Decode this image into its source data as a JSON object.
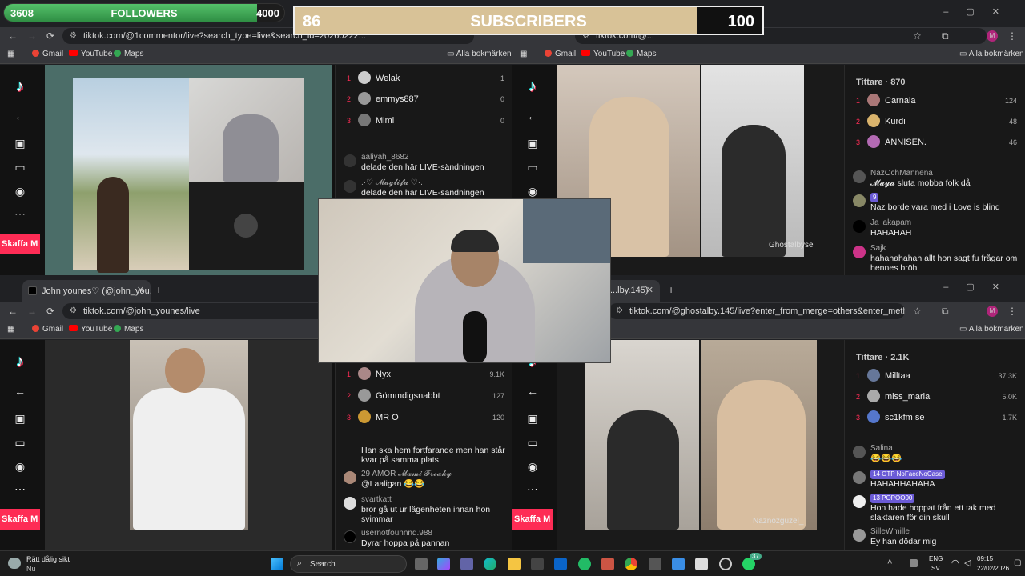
{
  "followers_bar": {
    "current": "3608",
    "label": "FOLLOWERS",
    "goal": "4000",
    "progress": 0.902
  },
  "subscribers_bar": {
    "current": "86",
    "label": "SUBSCRIBERS",
    "goal": "100",
    "progress": 0.86
  },
  "bookmarks": {
    "gmail": "Gmail",
    "youtube": "YouTube",
    "maps": "Maps",
    "all": "Alla bokmärken"
  },
  "win_tl": {
    "url": "tiktok.com/@1commentor/live?search_type=live&search_id=20260222...",
    "viewers": [
      {
        "rank": "1",
        "name": "Welak",
        "score": "1"
      },
      {
        "rank": "2",
        "name": "emmys887",
        "score": "0"
      },
      {
        "rank": "3",
        "name": "Mimi",
        "score": "0"
      }
    ],
    "events": [
      {
        "user": "aaliyah_8682",
        "text": "delade den här LIVE-sändningen"
      },
      {
        "user": ".·♡ 𝓜𝓪𝓰𝓵𝓲𝓯𝓪 ♡·.",
        "text": "delade den här LIVE-sändningen"
      }
    ],
    "skaffa": "Skaffa M"
  },
  "win_tr": {
    "url": "tiktok.com/@...",
    "viewer_title": "Tittare · 870",
    "viewers": [
      {
        "rank": "1",
        "name": "Carnala",
        "score": "124"
      },
      {
        "rank": "2",
        "name": "Kurdi",
        "score": "48"
      },
      {
        "rank": "3",
        "name": "ANNISEN.",
        "score": "46"
      }
    ],
    "comments": [
      {
        "user": "NazOchMannena",
        "text": "𝓜𝓪𝔂𝓪 sluta mobba folk då"
      },
      {
        "user": "9",
        "text": "Naz borde vara med i Love is blind"
      },
      {
        "user": "Ja jakapam",
        "text": "HAHAHAH"
      },
      {
        "user": "Sajk",
        "text": "hahahahahah allt hon sagt fu frågar om hennes bröh"
      }
    ],
    "video_label": "Ghostalbyse",
    "skaffa": "Skaffa M"
  },
  "win_bl": {
    "tab_title": "John younes♡ (@john_you...",
    "url": "tiktok.com/@john_younes/live",
    "viewers": [
      {
        "rank": "1",
        "name": "Nyx",
        "score": "9.1K"
      },
      {
        "rank": "2",
        "name": "Gömmdigsnabbt",
        "score": "127"
      },
      {
        "rank": "3",
        "name": "MR O",
        "score": "120"
      }
    ],
    "comments": [
      {
        "user": "",
        "text": "Han ska hem fortfarande men han står kvar på samma plats"
      },
      {
        "user": "29 AMOR 𝓜𝓪𝓶𝓲 𝓕𝓻𝓮𝓪𝓴𝔂",
        "text": "@Laaligan 😂😂"
      },
      {
        "user": "svartkatt",
        "text": "bror gå ut ur lägenheten innan hon svimmar"
      },
      {
        "user": "usernotfounnnd.988",
        "text": "Dyrar hoppa på pannan"
      }
    ],
    "skaffa": "Skaffa M"
  },
  "win_br": {
    "tab_title": "...lby.145)",
    "url": "tiktok.com/@ghostalby.145/live?enter_from_merge=others&enter_method=others",
    "viewer_title": "Tittare · 2.1K",
    "viewers": [
      {
        "rank": "1",
        "name": "Milltaa",
        "score": "37.3K"
      },
      {
        "rank": "2",
        "name": "miss_maria",
        "score": "5.0K"
      },
      {
        "rank": "3",
        "name": "sc1kfm se",
        "score": "1.7K"
      }
    ],
    "comments": [
      {
        "user": "Salina",
        "text": "😂😂😂"
      },
      {
        "user": "14 OTP NoFaceNoCase",
        "text": "HAHAHHAHAHA"
      },
      {
        "user": "13 POPOO00",
        "text": "Hon hade hoppat från ett tak med slaktaren för din skull"
      },
      {
        "user": "SilleWmille",
        "text": "Ey han dödar mig"
      }
    ],
    "video_label": "Naznozguzel_",
    "skaffa": "Skaffa M"
  },
  "taskbar": {
    "weather_title": "Rätt dålig sikt",
    "weather_sub": "Nu",
    "search": "Search",
    "lang": "ENG",
    "lang_sub": "SV",
    "time": "09:15",
    "date": "22/02/2026",
    "badge": "37"
  }
}
